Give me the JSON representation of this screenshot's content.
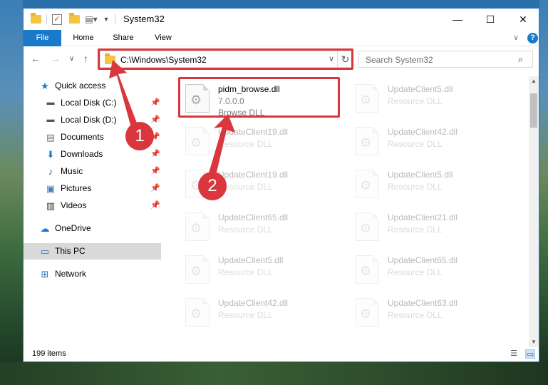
{
  "window": {
    "title": "System32",
    "controls": {
      "minimize": "—",
      "maximize": "☐",
      "close": "✕"
    }
  },
  "ribbon": {
    "tabs": [
      "File",
      "Home",
      "Share",
      "View"
    ],
    "help": "?"
  },
  "address": {
    "path": "C:\\Windows\\System32",
    "search_placeholder": "Search System32"
  },
  "sidebar": {
    "items": [
      {
        "label": "Quick access",
        "icon": "star-icon",
        "pinned": false
      },
      {
        "label": "Local Disk (C:)",
        "icon": "drive-icon",
        "pinned": true
      },
      {
        "label": "Local Disk (D:)",
        "icon": "drive-icon",
        "pinned": true
      },
      {
        "label": "Documents",
        "icon": "documents-icon",
        "pinned": true
      },
      {
        "label": "Downloads",
        "icon": "downloads-icon",
        "pinned": true
      },
      {
        "label": "Music",
        "icon": "music-icon",
        "pinned": true
      },
      {
        "label": "Pictures",
        "icon": "pictures-icon",
        "pinned": true
      },
      {
        "label": "Videos",
        "icon": "videos-icon",
        "pinned": true
      },
      {
        "label": "OneDrive",
        "icon": "onedrive-icon",
        "pinned": false
      },
      {
        "label": "This PC",
        "icon": "computer-icon",
        "pinned": false,
        "selected": true
      },
      {
        "label": "Network",
        "icon": "network-icon",
        "pinned": false
      }
    ]
  },
  "files": [
    {
      "name": "pidm_browse.dll",
      "version": "7.0.0.0",
      "type": "Browse DLL",
      "highlighted": true
    },
    {
      "name": "UpdateClient5.dll",
      "type": "Resource DLL"
    },
    {
      "name": "UpdateClient19.dll",
      "type": "Resource DLL"
    },
    {
      "name": "UpdateClient42.dll",
      "type": "Resource DLL"
    },
    {
      "name": "UpdateClient19.dll",
      "type": "Resource DLL"
    },
    {
      "name": "UpdateClient5.dll",
      "type": "Resource DLL"
    },
    {
      "name": "UpdateClient65.dll",
      "type": "Resource DLL"
    },
    {
      "name": "UpdateClient21.dll",
      "type": "Resource DLL"
    },
    {
      "name": "UpdateClient5.dll",
      "type": "Resource DLL"
    },
    {
      "name": "UpdateClient65.dll",
      "type": "Resource DLL"
    },
    {
      "name": "UpdateClient42.dll",
      "type": "Resource DLL"
    },
    {
      "name": "UpdateClient63.dll",
      "type": "Resource DLL"
    }
  ],
  "status": {
    "item_count": "199 items"
  },
  "callouts": [
    "1",
    "2"
  ],
  "colors": {
    "accent": "#1979ca",
    "callout": "#d9363e"
  }
}
